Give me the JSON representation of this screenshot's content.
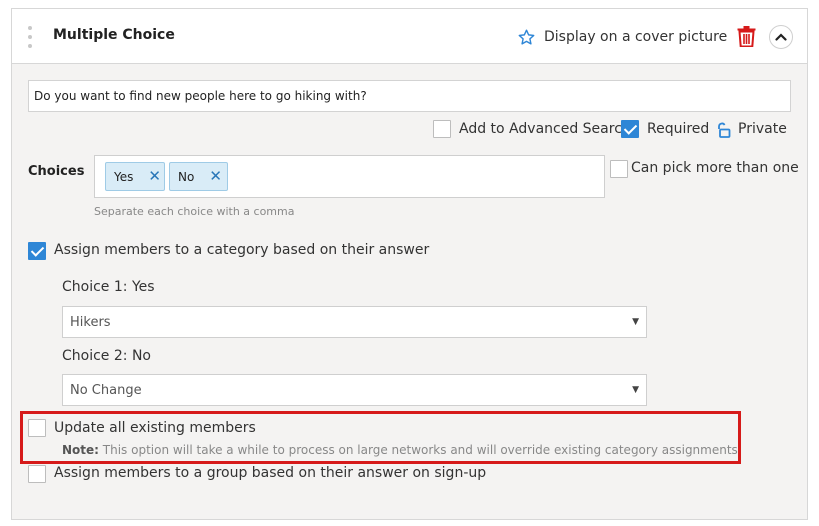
{
  "header": {
    "title": "Multiple Choice",
    "cover_label": "Display on a cover picture",
    "icons": {
      "drag": "drag-handle-icon",
      "cover": "star-icon",
      "delete": "trash-icon",
      "collapse": "chevron-up-icon"
    }
  },
  "question": {
    "value": "Do you want to find new people here to go hiking with?"
  },
  "options": {
    "advanced_search": {
      "label": "Add to Advanced Search",
      "checked": false
    },
    "required": {
      "label": "Required",
      "checked": true
    },
    "private": {
      "label": "Private",
      "icon": "lock-open-icon"
    }
  },
  "choices": {
    "label": "Choices",
    "items": [
      {
        "label": "Yes",
        "remove": "✕"
      },
      {
        "label": "No",
        "remove": "✕"
      }
    ],
    "hint": "Separate each choice with a comma",
    "multi": {
      "label": "Can pick more than one",
      "checked": false
    }
  },
  "category_assignment": {
    "label": "Assign members to a category based on their answer",
    "checked": true,
    "rows": [
      {
        "label": "Choice 1: Yes",
        "selected": "Hikers"
      },
      {
        "label": "Choice 2: No",
        "selected": "No Change"
      }
    ],
    "caret": "▼"
  },
  "update_existing": {
    "label": "Update all existing members",
    "checked": false,
    "note_prefix": "Note:",
    "note_text": " This option will take a while to process on large networks and will override existing category assignments"
  },
  "group_assignment": {
    "label": "Assign members to a group based on their answer on sign-up",
    "checked": false
  },
  "colors": {
    "accent": "#2e86d6",
    "danger": "#d61a1a",
    "chip_bg": "#d9ecf7"
  }
}
